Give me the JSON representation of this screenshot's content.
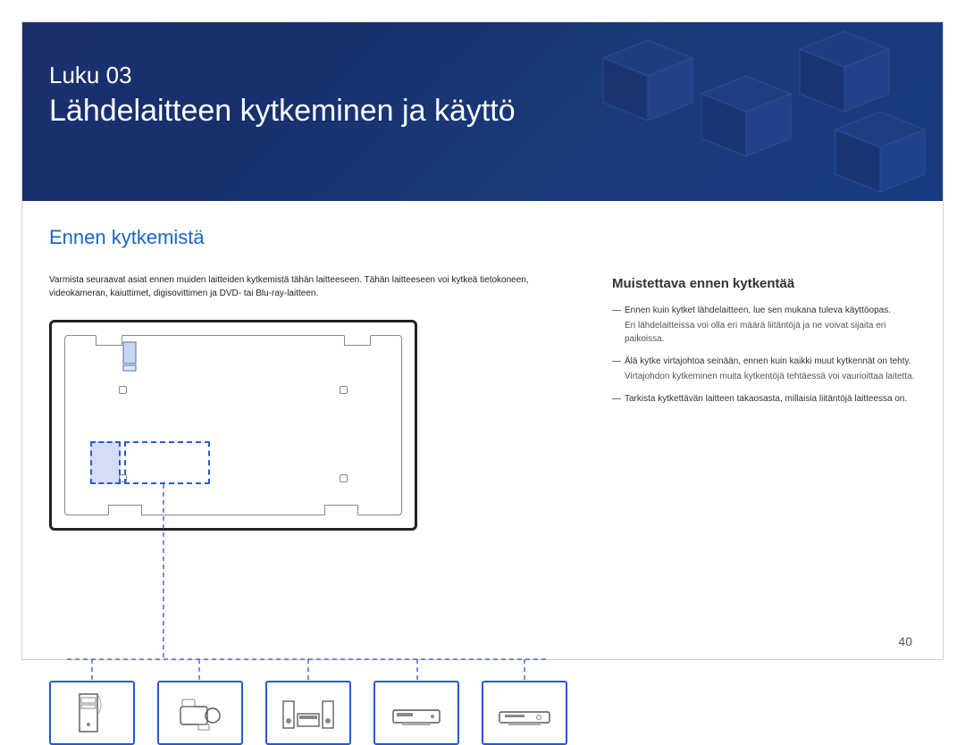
{
  "chapter": {
    "label": "Luku  03",
    "title": "Lähdelaitteen kytkeminen ja käyttö"
  },
  "section": {
    "title": "Ennen kytkemistä"
  },
  "intro": "Varmista seuraavat asiat ennen muiden laitteiden kytkemistä tähän laitteeseen. Tähän laitteeseen voi kytkeä tietokoneen, videokameran, kaiuttimet, digisovittimen ja DVD- tai Blu-ray-laitteen.",
  "right": {
    "subtitle": "Muistettava ennen kytkentää",
    "items": [
      {
        "main": "Ennen kuin kytket lähdelaitteen, lue sen mukana tuleva käyttöopas.",
        "sub": "Eri lähdelaitteissa voi olla eri määrä liitäntöjä ja ne voivat sijaita eri paikoissa."
      },
      {
        "main": "Älä kytke virtajohtoa seinään, ennen kuin kaikki muut kytkennät on tehty.",
        "sub": "Virtajohdon kytkeminen muita kytkentöjä tehtäessä voi vaurioittaa laitetta."
      },
      {
        "main": "Tarkista kytkettävän laitteen takaosasta, millaisia liitäntöjä laitteessa on.",
        "sub": ""
      }
    ]
  },
  "devices": [
    "pc-tower",
    "camcorder",
    "stereo-speakers",
    "set-top-box",
    "dvd-player"
  ],
  "pageNumber": "40"
}
